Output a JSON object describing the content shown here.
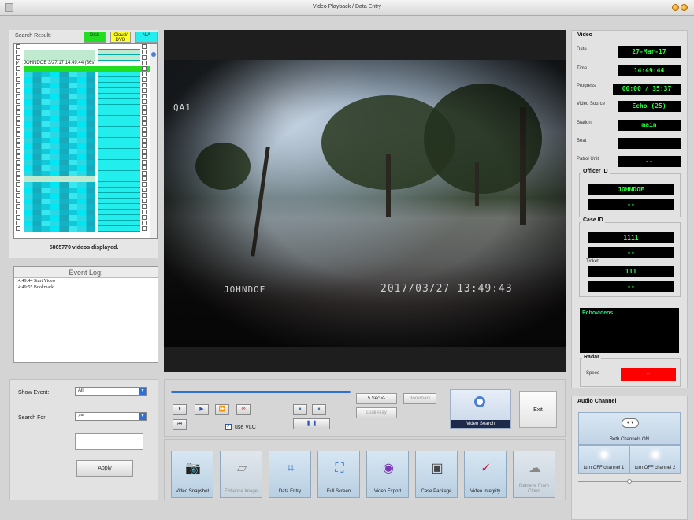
{
  "window": {
    "title": "Video Playback / Data Entry"
  },
  "search": {
    "title": "Search Result:",
    "chip_disk": "Disk",
    "chip_cloud": "Cloud/ DVD",
    "chip_na": "N/A",
    "selected_row_text": "JOHNDOE 3/27/17 14:49:44 (36s)",
    "videos_displayed": "5865770 videos displayed."
  },
  "event_log": {
    "title": "Event Log:",
    "lines": [
      "14:49:44 Start Video",
      "14:49:55 Bookmark"
    ]
  },
  "filters": {
    "show_event_label": "Show Event:",
    "show_event_value": "All",
    "search_for_label": "Search For:",
    "search_for_value": ">=",
    "search_text": "",
    "apply_label": "Apply"
  },
  "video": {
    "osd_camera": "QA1",
    "osd_officer": "JOHNDOE",
    "osd_timestamp": "2017/03/27 13:49:43"
  },
  "transport": {
    "skip_label": "5 Sec <-",
    "bookmark_label": "Bookmark",
    "dual_play_label": "Dual Play",
    "use_vlc_label": "use VLC",
    "use_vlc_checked": true,
    "video_search_label": "Video Search",
    "exit_label": "Exit"
  },
  "tools": [
    {
      "label": "Video Snapshot",
      "icon": "camera-icon",
      "enabled": true
    },
    {
      "label": "Enhance Image",
      "icon": "enhance-icon",
      "enabled": false
    },
    {
      "label": "Data Entry",
      "icon": "data-entry-icon",
      "enabled": true
    },
    {
      "label": "Full Screen",
      "icon": "fullscreen-icon",
      "enabled": true
    },
    {
      "label": "Video Export",
      "icon": "export-icon",
      "enabled": true
    },
    {
      "label": "Case Package",
      "icon": "package-icon",
      "enabled": true
    },
    {
      "label": "Video Integrity",
      "icon": "integrity-icon",
      "enabled": true
    },
    {
      "label": "Retrieve From Cloud",
      "icon": "cloud-icon",
      "enabled": false
    }
  ],
  "video_info": {
    "section_title": "Video",
    "date_label": "Date",
    "date_value": "27-Mar-17",
    "time_label": "Time",
    "time_value": "14:49:44",
    "progress_label": "Progress",
    "progress_value": "00:00 / 35:37",
    "source_label": "Video Source",
    "source_value": "Echo (25)",
    "station_label": "Station",
    "station_value": "main",
    "beat_label": "Beat",
    "beat_value": "",
    "patrol_label": "Patrol Unit",
    "patrol_value": "--",
    "officer_title": "Officer ID",
    "officer_value": "JOHNDOE",
    "officer_value2": "--",
    "case_title": "Case ID",
    "case_value": "1111",
    "case_value2": "--",
    "ticket_label": "Ticket",
    "ticket_value": "111",
    "ticket_value2": "--",
    "echovideos_label": "Echovideos",
    "radar_title": "Radar",
    "speed_label": "Speed",
    "speed_value": "--"
  },
  "audio": {
    "title": "Audio Channel",
    "both_label": "Both Channels ON",
    "ch1_label": "turn OFF channel 1",
    "ch2_label": "turn OFF channel 2"
  },
  "colors": {
    "disk": "#22dd22",
    "cloud": "#ffff22",
    "na": "#22eeee",
    "lcd_text": "#2aff3c",
    "accent_blue": "#2f6fd8",
    "radar": "#ff0000"
  }
}
